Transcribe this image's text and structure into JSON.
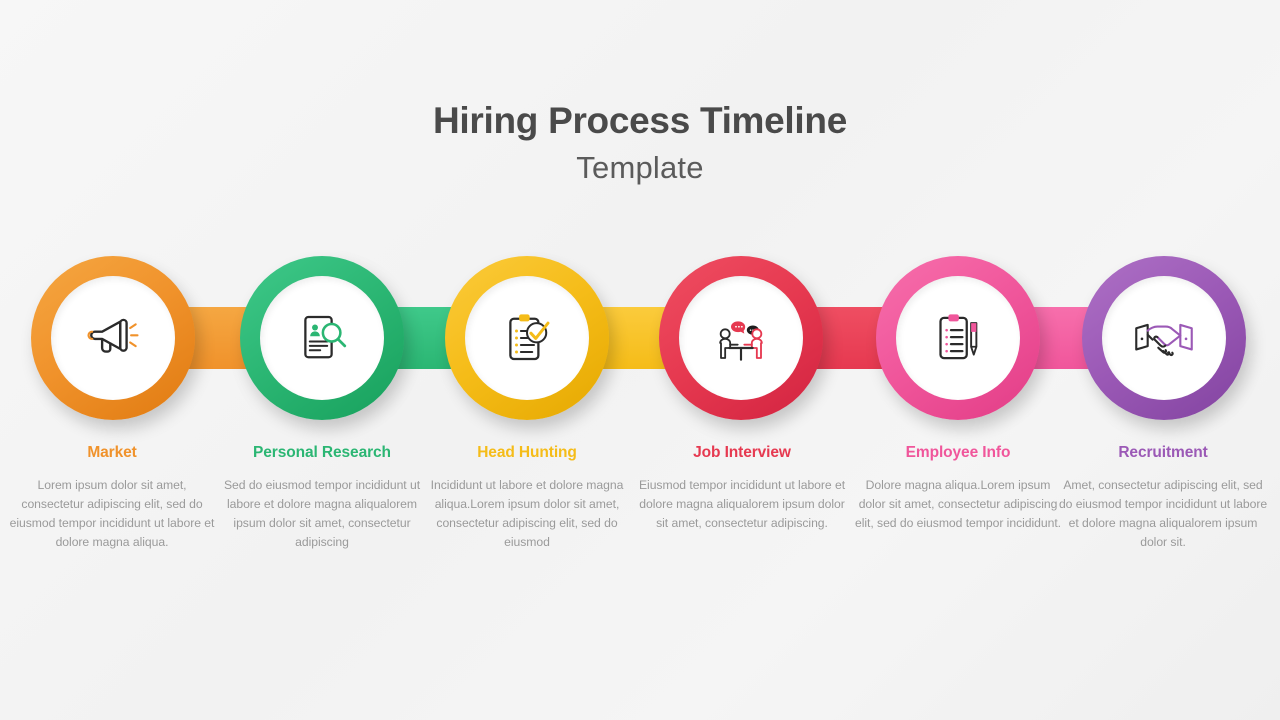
{
  "header": {
    "title": "Hiring Process Timeline",
    "subtitle": "Template"
  },
  "theme": {
    "background": "#f3f3f3",
    "title_color": "#4a4a4a",
    "subtitle_color": "#5b5b5b",
    "description_color": "#9a9a9a"
  },
  "steps": [
    {
      "id": "market",
      "label": "Market",
      "icon": "megaphone-icon",
      "color": "#F0922B",
      "color_light": "#F5A742",
      "color_dark": "#E07A10",
      "description": "Lorem ipsum dolor sit amet, consectetur adipiscing elit, sed do eiusmod tempor incididunt ut labore et dolore magna aliqua."
    },
    {
      "id": "personal-research",
      "label": "Personal Research",
      "icon": "resume-search-icon",
      "color": "#2BB673",
      "color_light": "#3FC98A",
      "color_dark": "#17A05C",
      "description": "Sed do eiusmod tempor incididunt ut labore et dolore magna aliqualorem ipsum dolor sit amet, consectetur adipiscing"
    },
    {
      "id": "head-hunting",
      "label": "Head Hunting",
      "icon": "checklist-check-icon",
      "color": "#F5BC18",
      "color_light": "#FBCB3C",
      "color_dark": "#E5A800",
      "description": "Incididunt ut labore et dolore magna aliqua.Lorem ipsum dolor sit amet, consectetur adipiscing elit, sed do eiusmod"
    },
    {
      "id": "job-interview",
      "label": "Job Interview",
      "icon": "interview-icon",
      "color": "#E63950",
      "color_light": "#EF4E62",
      "color_dark": "#D22340",
      "description": "Eiusmod tempor incididunt ut labore et dolore magna aliqualorem ipsum dolor sit amet, consectetur adipiscing."
    },
    {
      "id": "employee-info",
      "label": "Employee Info",
      "icon": "clipboard-pen-icon",
      "color": "#F0569B",
      "color_light": "#F76FAC",
      "color_dark": "#E23C86",
      "description": "Dolore magna aliqua.Lorem ipsum dolor sit amet, consectetur adipiscing elit, sed do eiusmod tempor incididunt."
    },
    {
      "id": "recruitment",
      "label": "Recruitment",
      "icon": "handshake-icon",
      "color": "#9B59B6",
      "color_light": "#AE71C6",
      "color_dark": "#8243A0",
      "description": "Amet, consectetur adipiscing elit, sed do eiusmod tempor incididunt ut labore et dolore magna aliqualorem ipsum dolor sit."
    }
  ]
}
